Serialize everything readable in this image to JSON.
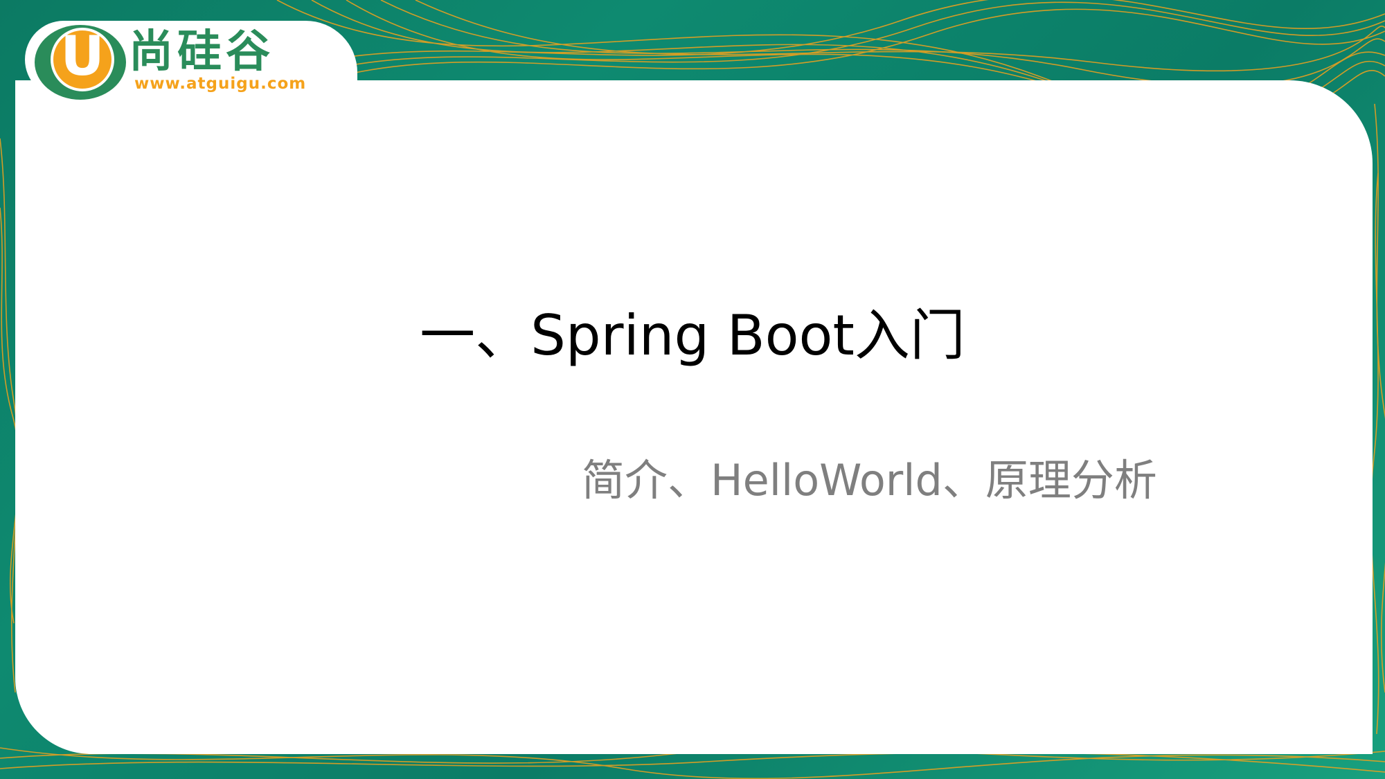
{
  "slide": {
    "title": "一、Spring Boot入门",
    "subtitle": "简介、HelloWorld、原理分析"
  },
  "logo": {
    "letter": "U",
    "name_cn": "尚硅谷",
    "url": "www.atguigu.com"
  },
  "colors": {
    "background_green": "#0c7a63",
    "accent_orange": "#f5a21b",
    "logo_green": "#2a8c5a",
    "title_text": "#000000",
    "subtitle_text": "#7f7f7f",
    "card": "#ffffff"
  }
}
